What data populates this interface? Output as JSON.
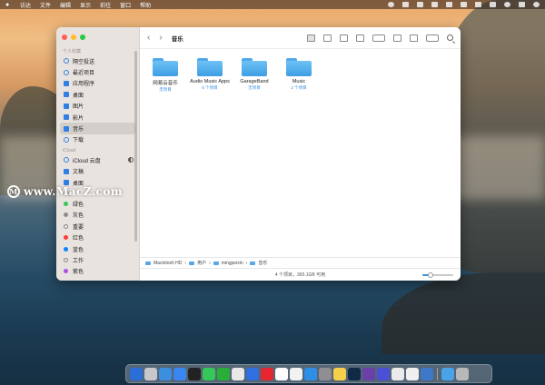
{
  "menubar": {
    "apple": "",
    "items": [
      "访达",
      "文件",
      "编辑",
      "显示",
      "前往",
      "窗口",
      "帮助"
    ]
  },
  "watermark": {
    "logo": "M",
    "text": "www.MacZ.com"
  },
  "window": {
    "title": "音乐",
    "nav_back": "‹",
    "nav_forward": "›"
  },
  "sidebar": {
    "favorites_label": "个人收藏",
    "favorites": [
      "隔空投送",
      "最近项目",
      "应用程序",
      "桌面",
      "图片",
      "影片",
      "音乐",
      "下载"
    ],
    "icloud_label": "iCloud",
    "icloud": [
      "iCloud 云盘",
      "文稿",
      "桌面"
    ],
    "tags_label": "标签",
    "tags": [
      {
        "label": "绿色",
        "color": "#34c759"
      },
      {
        "label": "灰色",
        "color": "#8e8e93"
      },
      {
        "label": "重要",
        "color": "hollow"
      },
      {
        "label": "红色",
        "color": "#ff3b30"
      },
      {
        "label": "蓝色",
        "color": "#0a84ff"
      },
      {
        "label": "工作",
        "color": "hollow"
      },
      {
        "label": "紫色",
        "color": "#af52de"
      }
    ]
  },
  "files": [
    {
      "name": "网易云音乐",
      "sub": "无项目"
    },
    {
      "name": "Audio Music Apps",
      "sub": "6 个项目"
    },
    {
      "name": "GarageBand",
      "sub": "无项目"
    },
    {
      "name": "Music",
      "sub": "2 个项目"
    }
  ],
  "pathbar": [
    "Macintosh HD",
    "用户",
    "mingjunxin",
    "音乐"
  ],
  "status": {
    "text": "4 个项目，365.1GB 可用",
    "icon_size_fraction": 0.25
  },
  "colors": {
    "accent": "#3b8ee0",
    "folder": "#4fa8e8"
  }
}
